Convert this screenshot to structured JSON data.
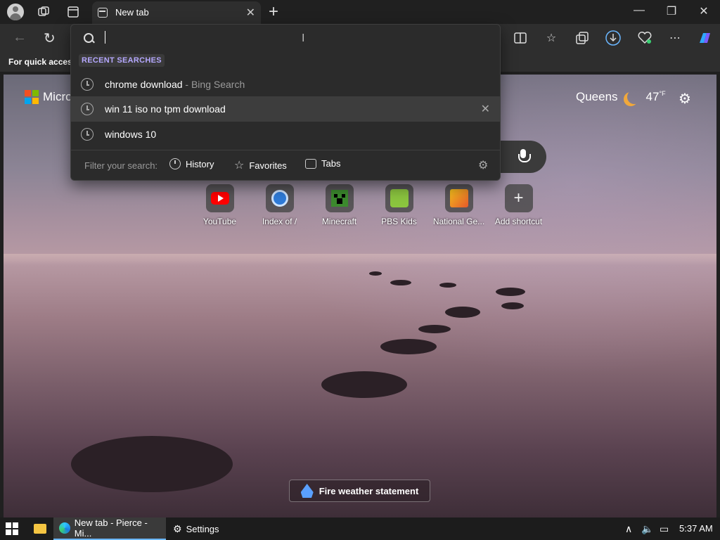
{
  "browser": {
    "tab_title": "New tab",
    "favorites_hint": "For quick access",
    "tab_close": "✕",
    "new_tab": "+"
  },
  "window_controls": {
    "minimize": "—",
    "restore": "❐",
    "close": "✕"
  },
  "omnibox": {
    "value": "",
    "recent_searches_label": "RECENT SEARCHES",
    "items": [
      {
        "text": "chrome download",
        "suffix": " - Bing Search"
      },
      {
        "text": "win 11 iso no tpm download",
        "suffix": ""
      },
      {
        "text": "windows 10",
        "suffix": ""
      }
    ],
    "filter_label": "Filter your search:",
    "filters": [
      "History",
      "Favorites",
      "Tabs"
    ]
  },
  "newtab": {
    "logo_text": "Micro",
    "weather_city": "Queens",
    "weather_temp": "47",
    "weather_unit": "°F",
    "shortcuts": [
      {
        "label": "YouTube",
        "icon": "youtube-icon"
      },
      {
        "label": "Index of /",
        "icon": "ie-icon"
      },
      {
        "label": "Minecraft",
        "icon": "minecraft-icon"
      },
      {
        "label": "PBS Kids",
        "icon": "pbs-kids-icon"
      },
      {
        "label": "National Ge...",
        "icon": "natgeo-icon"
      },
      {
        "label": "Add shortcut",
        "icon": "plus-icon"
      }
    ],
    "alert": "Fire weather statement"
  },
  "taskbar": {
    "apps": [
      {
        "label": "New tab - Pierce - Mi...",
        "icon": "edge-icon"
      },
      {
        "label": "Settings",
        "icon": "gear-icon"
      }
    ],
    "clock": "5:37 AM"
  },
  "colors": {
    "accent": "#b5a8ff",
    "youtube": "#ff0000",
    "taskbar_active": "#6bb7ff"
  }
}
